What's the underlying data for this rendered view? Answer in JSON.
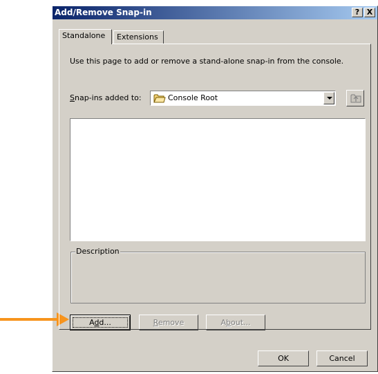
{
  "window": {
    "title": "Add/Remove Snap-in",
    "help_button": "?",
    "close_button": "X"
  },
  "tabs": [
    {
      "label": "Standalone",
      "active": true
    },
    {
      "label": "Extensions",
      "active": false
    }
  ],
  "standalone": {
    "instruction": "Use this page to add or remove a stand-alone snap-in from the console.",
    "snapins_label_mnemonic": "S",
    "snapins_label_rest": "nap-ins added to:",
    "combo_value": "Console Root",
    "combo_icon": "folder-icon",
    "up_level_icon": "up-one-level-icon",
    "snapin_list": [],
    "description_label": "Description",
    "description_text": ""
  },
  "buttons": {
    "add_pre": "A",
    "add_mnemonic": "d",
    "add_post": "d...",
    "remove_mnemonic": "R",
    "remove_rest": "emove",
    "about_pre": "A",
    "about_mnemonic": "b",
    "about_post": "out...",
    "ok": "OK",
    "cancel": "Cancel"
  },
  "annotation": {
    "arrow_color": "#f7941d",
    "points_to": "add-button"
  },
  "colors": {
    "dialog_face": "#d4d0c8",
    "title_gradient_start": "#0a246a",
    "title_gradient_end": "#a6caf0",
    "disabled_text": "#808080"
  }
}
